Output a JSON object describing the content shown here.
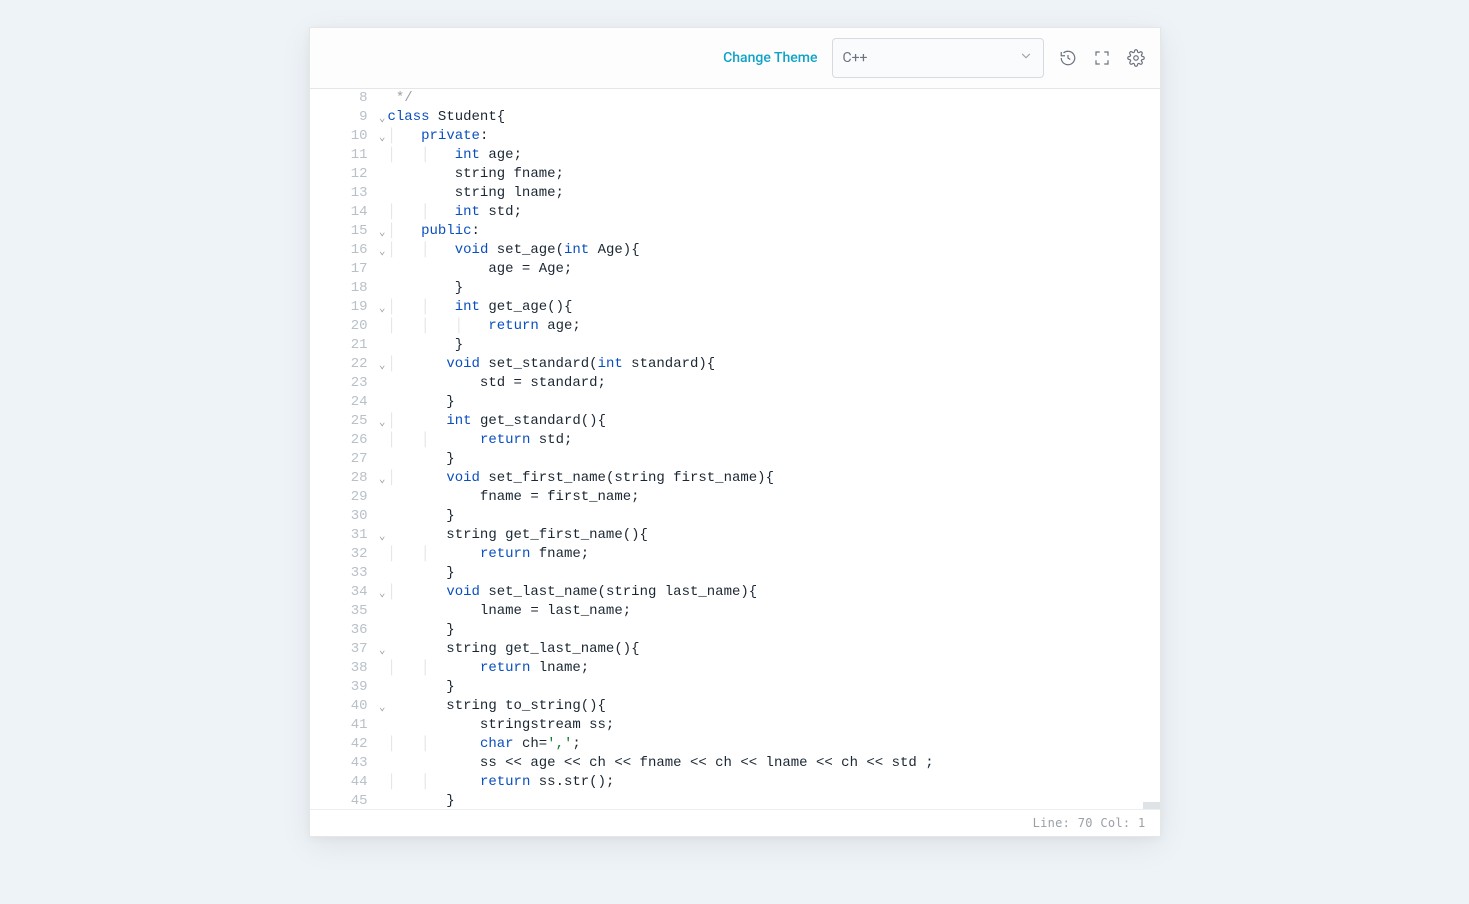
{
  "toolbar": {
    "change_theme": "Change Theme",
    "language": "C++"
  },
  "status": {
    "line_label": "Line:",
    "line": "70",
    "col_label": "Col:",
    "col": "1"
  },
  "editor": {
    "first_line_number": 8,
    "lines": [
      {
        "fold": false,
        "tokens": [
          [
            "p",
            " "
          ],
          [
            "cm",
            "*/"
          ]
        ]
      },
      {
        "fold": true,
        "tokens": [
          [
            "kw",
            "class"
          ],
          [
            "p",
            " Student{"
          ]
        ]
      },
      {
        "fold": true,
        "tokens": [
          [
            "p",
            "    "
          ],
          [
            "kw",
            "private"
          ],
          [
            "p",
            ":"
          ]
        ]
      },
      {
        "fold": false,
        "tokens": [
          [
            "p",
            "        "
          ],
          [
            "kw",
            "int"
          ],
          [
            "p",
            " age;"
          ]
        ]
      },
      {
        "fold": false,
        "tokens": [
          [
            "p",
            "        string fname;"
          ]
        ]
      },
      {
        "fold": false,
        "tokens": [
          [
            "p",
            "        string lname;"
          ]
        ]
      },
      {
        "fold": false,
        "tokens": [
          [
            "p",
            "        "
          ],
          [
            "kw",
            "int"
          ],
          [
            "p",
            " std;"
          ]
        ]
      },
      {
        "fold": true,
        "tokens": [
          [
            "p",
            "    "
          ],
          [
            "kw",
            "public"
          ],
          [
            "p",
            ":"
          ]
        ]
      },
      {
        "fold": true,
        "tokens": [
          [
            "p",
            "        "
          ],
          [
            "kw",
            "void"
          ],
          [
            "p",
            " set_age("
          ],
          [
            "kw",
            "int"
          ],
          [
            "p",
            " Age){"
          ]
        ]
      },
      {
        "fold": false,
        "tokens": [
          [
            "p",
            "            age = Age;"
          ]
        ]
      },
      {
        "fold": false,
        "tokens": [
          [
            "p",
            "        }"
          ]
        ]
      },
      {
        "fold": true,
        "tokens": [
          [
            "p",
            "        "
          ],
          [
            "kw",
            "int"
          ],
          [
            "p",
            " get_age(){"
          ]
        ]
      },
      {
        "fold": false,
        "tokens": [
          [
            "p",
            "            "
          ],
          [
            "kw",
            "return"
          ],
          [
            "p",
            " age;"
          ]
        ]
      },
      {
        "fold": false,
        "tokens": [
          [
            "p",
            "        }"
          ]
        ]
      },
      {
        "fold": true,
        "tokens": [
          [
            "p",
            "       "
          ],
          [
            "kw",
            "void"
          ],
          [
            "p",
            " set_standard("
          ],
          [
            "kw",
            "int"
          ],
          [
            "p",
            " standard){"
          ]
        ]
      },
      {
        "fold": false,
        "tokens": [
          [
            "p",
            "           std = standard;"
          ]
        ]
      },
      {
        "fold": false,
        "tokens": [
          [
            "p",
            "       }"
          ]
        ]
      },
      {
        "fold": true,
        "tokens": [
          [
            "p",
            "       "
          ],
          [
            "kw",
            "int"
          ],
          [
            "p",
            " get_standard(){"
          ]
        ]
      },
      {
        "fold": false,
        "tokens": [
          [
            "p",
            "           "
          ],
          [
            "kw",
            "return"
          ],
          [
            "p",
            " std;"
          ]
        ]
      },
      {
        "fold": false,
        "tokens": [
          [
            "p",
            "       }"
          ]
        ]
      },
      {
        "fold": true,
        "tokens": [
          [
            "p",
            "       "
          ],
          [
            "kw",
            "void"
          ],
          [
            "p",
            " set_first_name(string first_name){"
          ]
        ]
      },
      {
        "fold": false,
        "tokens": [
          [
            "p",
            "           fname = first_name;"
          ]
        ]
      },
      {
        "fold": false,
        "tokens": [
          [
            "p",
            "       }"
          ]
        ]
      },
      {
        "fold": true,
        "tokens": [
          [
            "p",
            "       string get_first_name(){"
          ]
        ]
      },
      {
        "fold": false,
        "tokens": [
          [
            "p",
            "           "
          ],
          [
            "kw",
            "return"
          ],
          [
            "p",
            " fname;"
          ]
        ]
      },
      {
        "fold": false,
        "tokens": [
          [
            "p",
            "       }"
          ]
        ]
      },
      {
        "fold": true,
        "tokens": [
          [
            "p",
            "       "
          ],
          [
            "kw",
            "void"
          ],
          [
            "p",
            " set_last_name(string last_name){"
          ]
        ]
      },
      {
        "fold": false,
        "tokens": [
          [
            "p",
            "           lname = last_name;"
          ]
        ]
      },
      {
        "fold": false,
        "tokens": [
          [
            "p",
            "       }"
          ]
        ]
      },
      {
        "fold": true,
        "tokens": [
          [
            "p",
            "       string get_last_name(){"
          ]
        ]
      },
      {
        "fold": false,
        "tokens": [
          [
            "p",
            "           "
          ],
          [
            "kw",
            "return"
          ],
          [
            "p",
            " lname;"
          ]
        ]
      },
      {
        "fold": false,
        "tokens": [
          [
            "p",
            "       }"
          ]
        ]
      },
      {
        "fold": true,
        "tokens": [
          [
            "p",
            "       string to_string(){"
          ]
        ]
      },
      {
        "fold": false,
        "tokens": [
          [
            "p",
            "           stringstream ss;"
          ]
        ]
      },
      {
        "fold": false,
        "tokens": [
          [
            "p",
            "           "
          ],
          [
            "kw",
            "char"
          ],
          [
            "p",
            " ch="
          ],
          [
            "str",
            "','"
          ],
          [
            "p",
            ";"
          ]
        ]
      },
      {
        "fold": false,
        "tokens": [
          [
            "p",
            "           ss << age << ch << fname << ch << lname << ch << std ;"
          ]
        ]
      },
      {
        "fold": false,
        "tokens": [
          [
            "p",
            "           "
          ],
          [
            "kw",
            "return"
          ],
          [
            "p",
            " ss.str();"
          ]
        ]
      },
      {
        "fold": false,
        "tokens": [
          [
            "p",
            "       }"
          ]
        ]
      }
    ]
  }
}
